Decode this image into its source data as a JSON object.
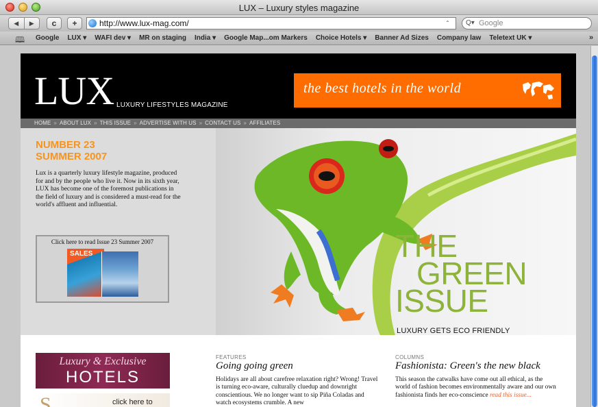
{
  "browser": {
    "window_title": "LUX – Luxury styles magazine",
    "nav_back": "◀",
    "nav_forward": "▶",
    "reload": "c",
    "add": "+",
    "url": "http://www.lux-mag.com/",
    "search_placeholder": "Google",
    "bookmarks": [
      "Google",
      "LUX ▾",
      "WAFI dev ▾",
      "MR on staging",
      "India ▾",
      "Google Map...om Markers",
      "Choice Hotels ▾",
      "Banner Ad Sizes",
      "Company law",
      "Teletext UK ▾"
    ],
    "bookmarks_more": "»"
  },
  "site": {
    "logo": "LUX",
    "logo_tagline": "LUXURY LIFESTYLES MAGAZINE",
    "banner_text": "the best hotels in the world",
    "nav": [
      "HOME",
      "ABOUT LUX",
      "THIS ISSUE",
      "ADVERTISE WITH US",
      "CONTACT US",
      "AFFILIATES"
    ],
    "nav_separator": "»",
    "issue": {
      "number": "NUMBER 23",
      "season": "SUMMER 2007",
      "intro": "Lux is a quarterly luxury lifestyle magazine, produced for and by the people who live it. Now in its sixth year, LUX has become one of the foremost publications in the field of luxury and is considered a must-read for the world's affluent and influential.",
      "read_label": "Click here to read Issue 23 Summer 2007",
      "cover_word": "SALES"
    },
    "hero": {
      "line1": "THE",
      "line2": "GREEN",
      "line3": "ISSUE",
      "subtitle": "LUXURY GETS ECO FRIENDLY"
    },
    "ads": {
      "hotels_script": "Luxury & Exclusive",
      "hotels_word": "HOTELS",
      "click_here": "click here to"
    },
    "features": {
      "kicker": "FEATURES",
      "title": "Going going green",
      "body": "Holidays are all about carefree relaxation right? Wrong! Travel is turning eco-aware, culturally cluedup and downright conscientious. We no longer want to sip Piña Coladas and watch ecosystems crumble. A new"
    },
    "columns": {
      "kicker": "COLUMNS",
      "title": "Fashionista: Green's the new black",
      "body": "This season the catwalks have come out all ethical, as the world of fashion becomes environmentally aware and our own fashionista finds her eco-conscience",
      "link": "read this issue..."
    }
  },
  "colors": {
    "accent_orange": "#f7941d",
    "banner_orange": "#ff6d00",
    "green": "#8db33a",
    "link_orange": "#f15a24"
  }
}
